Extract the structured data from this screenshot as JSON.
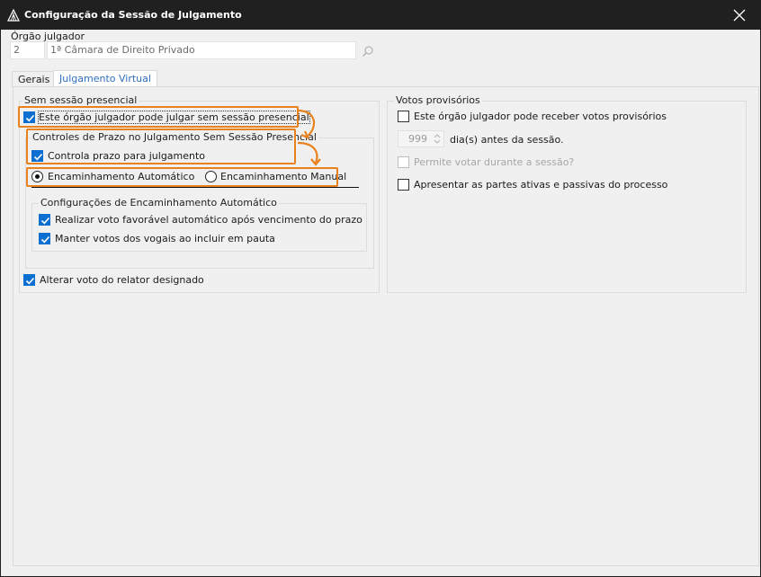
{
  "window": {
    "title": "Configuração da Sessão de Julgamento"
  },
  "orgao": {
    "label": "Órgão julgador",
    "code": "2",
    "name": "1ª Câmara de Direito Privado"
  },
  "tabs": [
    {
      "label": "Gerais"
    },
    {
      "label": "Julgamento Virtual"
    }
  ],
  "sem_sessao": {
    "legend": "Sem sessão presencial",
    "can_judge_label": "Este órgão julgador pode julgar sem sessão presencial",
    "controles": {
      "legend": "Controles de Prazo no Julgamento Sem Sessão Presencial",
      "controla_label": "Controla prazo para julgamento",
      "radio_auto_label": "Encaminhamento Automático",
      "radio_manual_label": "Encaminhamento Manual",
      "config": {
        "legend": "Configurações de Encaminhamento Automático",
        "voto_favoravel_label": "Realizar voto favorável automático após vencimento do prazo",
        "manter_votos_label": "Manter votos dos vogais ao incluir em pauta"
      }
    },
    "alterar_voto_label": "Alterar voto do relator designado"
  },
  "votos": {
    "legend": "Votos provisórios",
    "receber_label": "Este órgão julgador pode receber votos provisórios",
    "days_value": "999",
    "days_label": "dia(s) antes da sessão.",
    "permite_label": "Permite votar durante a sessão?",
    "apresentar_label": "Apresentar as partes ativas e passivas do processo"
  },
  "colors": {
    "accent": "#0a6fd0",
    "highlight": "#e8821e",
    "titlebar": "#202020"
  }
}
